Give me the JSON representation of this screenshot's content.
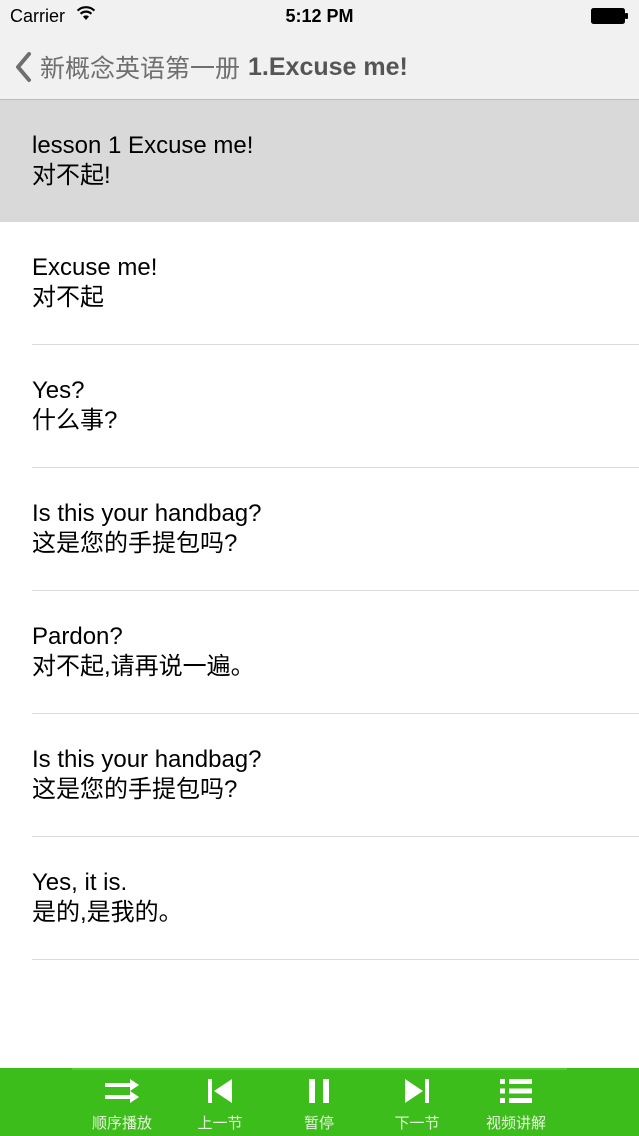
{
  "status_bar": {
    "carrier": "Carrier",
    "time": "5:12 PM"
  },
  "nav": {
    "back_label": "新概念英语第一册",
    "title": "1.Excuse me!"
  },
  "rows": [
    {
      "en": "lesson 1 Excuse me!",
      "zh": "对不起!",
      "selected": true
    },
    {
      "en": "Excuse me!",
      "zh": "对不起"
    },
    {
      "en": "Yes?",
      "zh": "什么事?"
    },
    {
      "en": "Is this your handbag?",
      "zh": "这是您的手提包吗?"
    },
    {
      "en": "Pardon?",
      "zh": "对不起,请再说一遍。"
    },
    {
      "en": "Is this your handbag?",
      "zh": "这是您的手提包吗?"
    },
    {
      "en": "Yes, it is.",
      "zh": "是的,是我的。"
    }
  ],
  "tabs": [
    {
      "label": "顺序播放",
      "icon": "sequential-play-icon"
    },
    {
      "label": "上一节",
      "icon": "previous-icon"
    },
    {
      "label": "暂停",
      "icon": "pause-icon"
    },
    {
      "label": "下一节",
      "icon": "next-icon"
    },
    {
      "label": "视频讲解",
      "icon": "list-icon"
    }
  ],
  "colors": {
    "tab_bar": "#3dbd1b",
    "selected_row": "#d9d9d9",
    "nav_bar": "#f1f1f1"
  }
}
